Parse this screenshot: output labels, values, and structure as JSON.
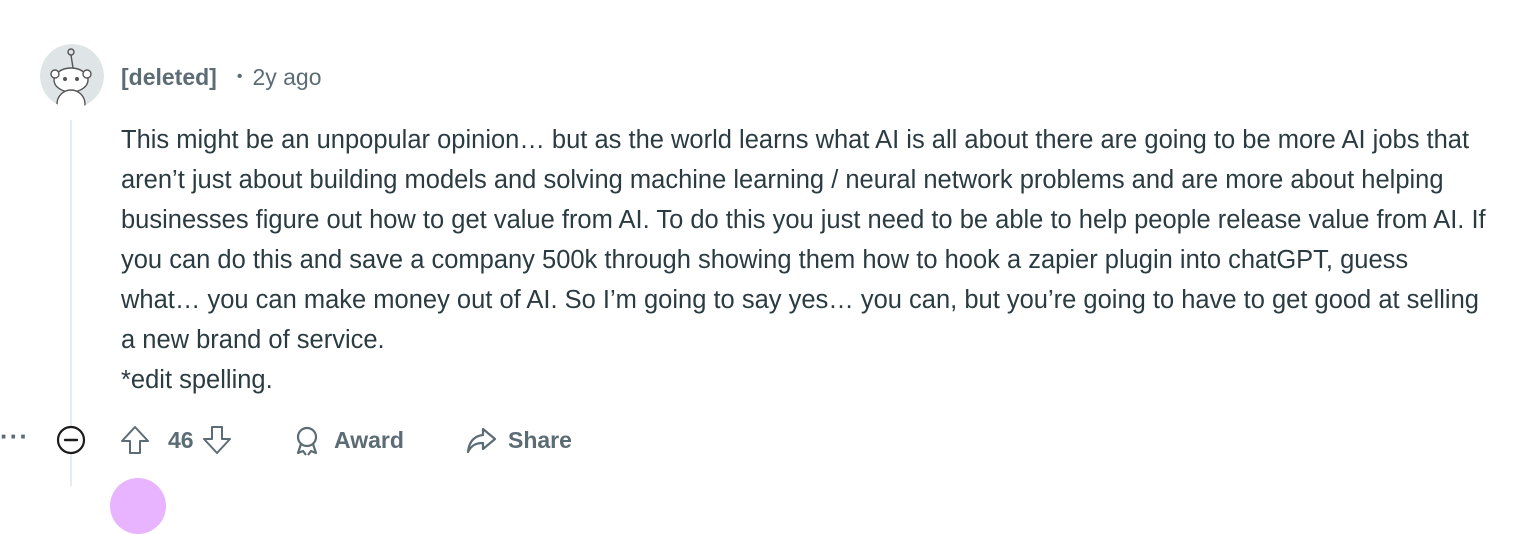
{
  "comment": {
    "author": "[deleted]",
    "separator": "•",
    "time": "2y ago",
    "body": "This might be an unpopular opinion… but as the world learns what AI is all about there are going to be more AI jobs that aren’t just about building models and solving machine learning / neural network problems and are more about helping businesses figure out how to get value from AI. To do this you just need to be able to help people release value from AI. If you can do this and save a company 500k through showing them how to hook a zapier plugin into chatGPT, guess what… you can make money out of AI. So I’m going to say yes… you can, but you’re going to have to get good at selling a new brand of service.",
    "edit_note": "*edit spelling."
  },
  "actions": {
    "score": "46",
    "award_label": "Award",
    "share_label": "Share",
    "more_label": "···"
  },
  "icons": {
    "avatar": "snoo-avatar-icon",
    "collapse": "collapse-minus-icon",
    "upvote": "upvote-arrow-icon",
    "downvote": "downvote-arrow-icon",
    "award": "award-icon",
    "share": "share-arrow-icon"
  },
  "colors": {
    "meta_text": "#5c6c74",
    "body_text": "#2a3c42",
    "thread_line": "#e5ebee",
    "next_avatar": "#e8b3ff"
  }
}
